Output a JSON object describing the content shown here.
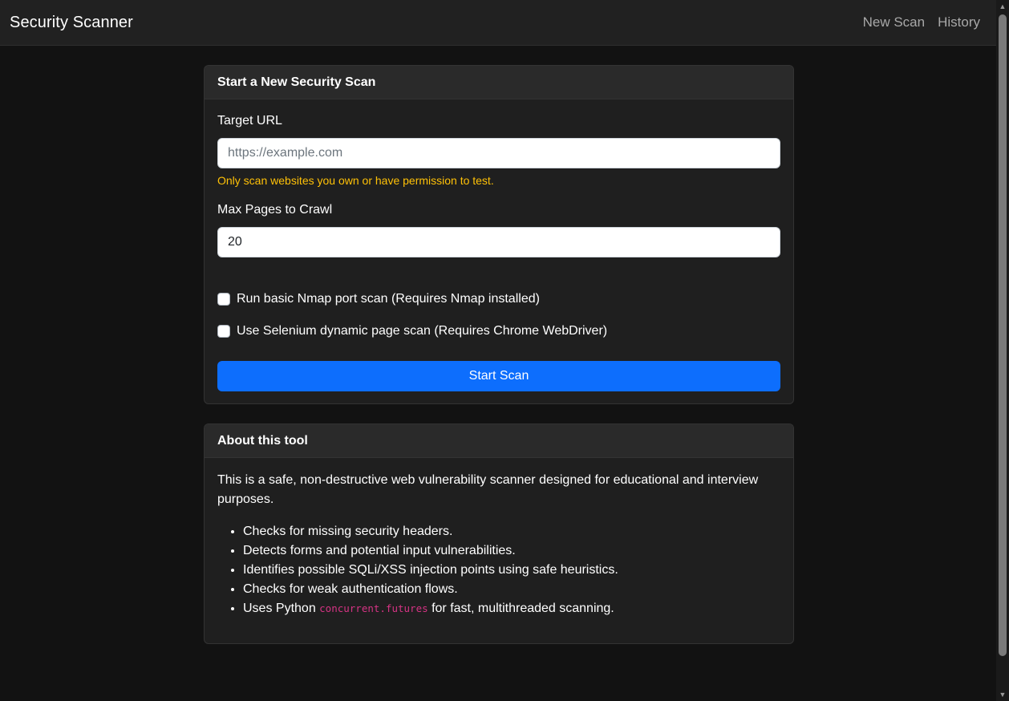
{
  "navbar": {
    "brand": "Security Scanner",
    "links": [
      "New Scan",
      "History"
    ]
  },
  "scan_card": {
    "header": "Start a New Security Scan",
    "target_url": {
      "label": "Target URL",
      "placeholder": "https://example.com",
      "value": "",
      "warning": "Only scan websites you own or have permission to test."
    },
    "max_pages": {
      "label": "Max Pages to Crawl",
      "value": "20"
    },
    "options": [
      {
        "label": "Run basic Nmap port scan (Requires Nmap installed)",
        "checked": false
      },
      {
        "label": "Use Selenium dynamic page scan (Requires Chrome WebDriver)",
        "checked": false
      }
    ],
    "submit_label": "Start Scan"
  },
  "about_card": {
    "header": "About this tool",
    "description": "This is a safe, non-destructive web vulnerability scanner designed for educational and interview purposes.",
    "features": [
      "Checks for missing security headers.",
      "Detects forms and potential input vulnerabilities.",
      "Identifies possible SQLi/XSS injection points using safe heuristics.",
      "Checks for weak authentication flows."
    ],
    "last_feature": {
      "prefix": "Uses Python ",
      "code": "concurrent.futures",
      "suffix": " for fast, multithreaded scanning."
    }
  },
  "colors": {
    "accent": "#0d6efd",
    "warning": "#ffc107",
    "code": "#d63384",
    "background": "#121212"
  }
}
